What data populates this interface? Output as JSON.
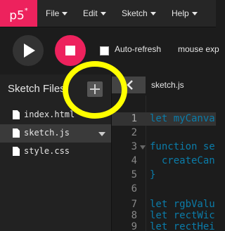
{
  "nav": {
    "logo": "p5",
    "logo_sup": "*",
    "menus": [
      {
        "label": "File"
      },
      {
        "label": "Edit"
      },
      {
        "label": "Sketch"
      },
      {
        "label": "Help"
      }
    ]
  },
  "toolbar": {
    "play_icon": "play-icon",
    "stop_icon": "stop-icon",
    "auto_refresh_label": "Auto-refresh",
    "auto_refresh_checked": false,
    "mouse_label": "mouse exp"
  },
  "sidebar": {
    "title": "Sketch Files",
    "add_icon": "plus-icon",
    "files": [
      {
        "name": "index.html",
        "active": false
      },
      {
        "name": "sketch.js",
        "active": true
      },
      {
        "name": "style.css",
        "active": false
      }
    ]
  },
  "editor": {
    "tab_filename": "sketch.js",
    "collapse_icon": "chevron-left-icon",
    "lines": [
      {
        "num": "1",
        "code": "let myCanva"
      },
      {
        "num": "2",
        "code": ""
      },
      {
        "num": "3",
        "code": "function se"
      },
      {
        "num": "4",
        "code": "  createCan"
      },
      {
        "num": "5",
        "code": "}"
      },
      {
        "num": "6",
        "code": ""
      },
      {
        "num": "7",
        "code": "let rgbValu"
      },
      {
        "num": "8",
        "code": "let rectWic"
      },
      {
        "num": "9",
        "code": "let rectHei"
      }
    ],
    "active_line": 1
  },
  "colors": {
    "accent": "#ed225d",
    "code_blue": "#0b7ca9",
    "annotation": "#ffff00"
  }
}
